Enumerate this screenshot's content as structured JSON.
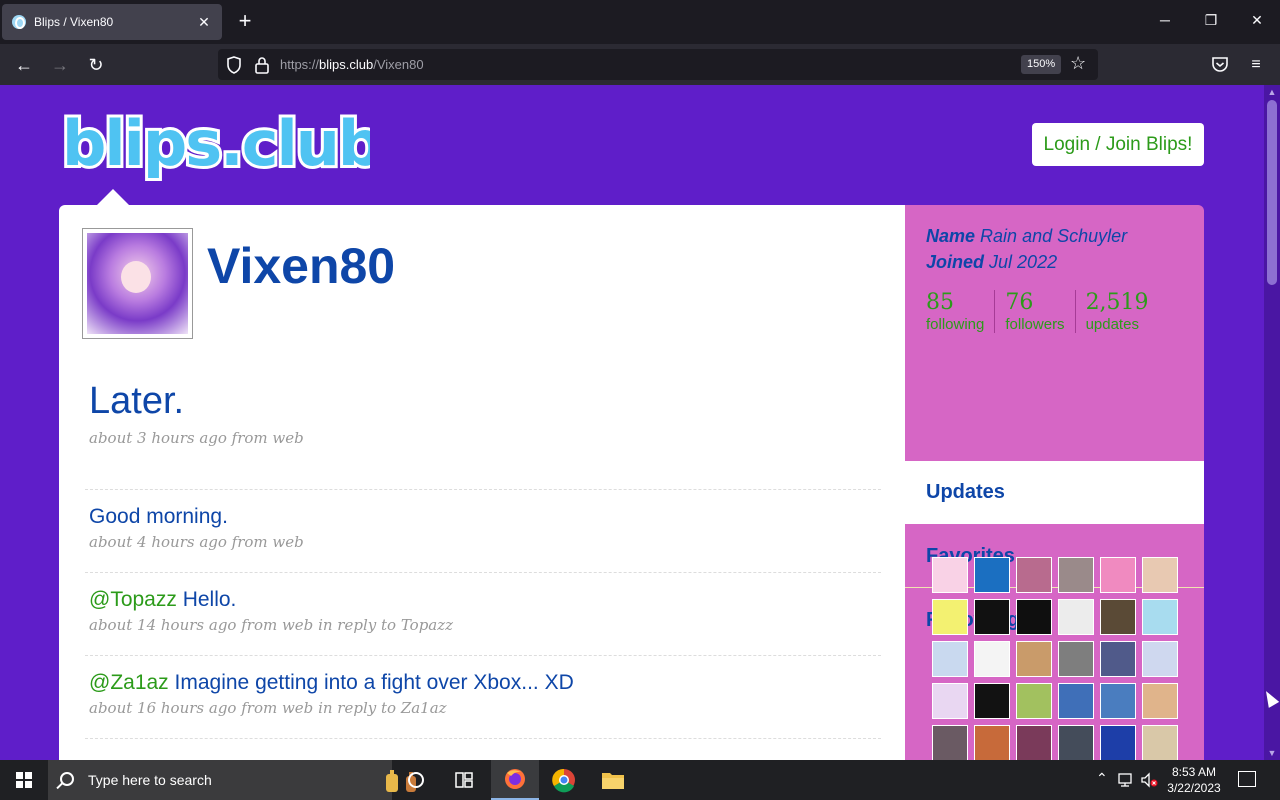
{
  "browser": {
    "tab_title": "Blips / Vixen80",
    "url_host": "blips.club",
    "url_prefix": "https://",
    "url_path": "/Vixen80",
    "zoom": "150%"
  },
  "site": {
    "logo_text": "blips.club",
    "login_label": "Login / Join Blips!"
  },
  "profile": {
    "username": "Vixen80",
    "name_label": "Name",
    "name_value": "Rain and Schuyler",
    "joined_label": "Joined",
    "joined_value": "Jul 2022",
    "stats": [
      {
        "num": "85",
        "label": "following"
      },
      {
        "num": "76",
        "label": "followers"
      },
      {
        "num": "2,519",
        "label": "updates"
      }
    ]
  },
  "sidebar": {
    "tabs": [
      {
        "label": "Updates"
      },
      {
        "label": "Favorites"
      },
      {
        "label": "Following"
      }
    ],
    "following_colors": [
      "#f9d2e6",
      "#1b6fc1",
      "#b86b8e",
      "#9a8a8a",
      "#f08ac0",
      "#e8c9b2",
      "#f3f171",
      "#111111",
      "#0f0f0f",
      "#ececec",
      "#5a4a36",
      "#a8dcef",
      "#c9d9ef",
      "#f4f4f4",
      "#c99b6a",
      "#7e7e7e",
      "#505a8a",
      "#cfd8ef",
      "#e9d7f2",
      "#121212",
      "#a2c15f",
      "#3f6fb8",
      "#4a7dbf",
      "#e0b48b",
      "#6a5a63",
      "#c76a3a",
      "#7a3a5a",
      "#444c5a",
      "#1d3ea8",
      "#d9c8a8"
    ]
  },
  "posts": [
    {
      "mention": "",
      "text": "Later.",
      "meta": "about 3 hours ago from web",
      "reply_to": ""
    },
    {
      "mention": "",
      "text": "Good morning.",
      "meta": "about 4 hours ago from web",
      "reply_to": ""
    },
    {
      "mention": "@Topazz",
      "text": " Hello.",
      "meta": "about 14 hours ago from web",
      "reply_to": "in reply to Topazz"
    },
    {
      "mention": "@Za1az",
      "text": " Imagine getting into a fight over Xbox... XD",
      "meta": "about 16 hours ago from web",
      "reply_to": "in reply to Za1az"
    }
  ],
  "taskbar": {
    "search_placeholder": "Type here to search",
    "time": "8:53 AM",
    "date": "3/22/2023"
  }
}
